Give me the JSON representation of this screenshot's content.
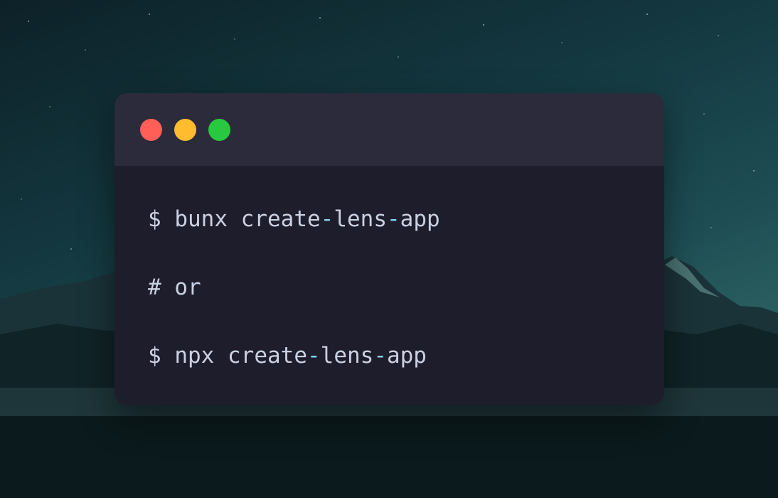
{
  "colors": {
    "close": "#ff5f57",
    "minimize": "#febc2e",
    "maximize": "#28c840",
    "accent": "#7fd4e8"
  },
  "terminal": {
    "lines": [
      {
        "prompt": "$",
        "command_parts": [
          "bunx create",
          "-",
          "lens",
          "-",
          "app"
        ]
      },
      {
        "prompt": "#",
        "command_parts": [
          "or"
        ]
      },
      {
        "prompt": "$",
        "command_parts": [
          "npx create",
          "-",
          "lens",
          "-",
          "app"
        ]
      }
    ]
  }
}
